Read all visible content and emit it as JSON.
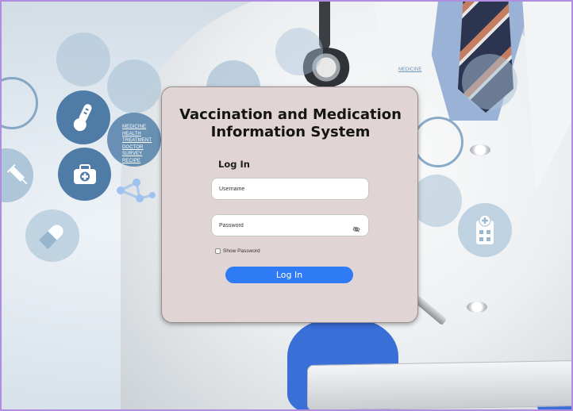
{
  "app": {
    "title_line1": "Vaccination and Medication",
    "title_line2": "Information System"
  },
  "login": {
    "heading": "Log In",
    "username_placeholder": "Username",
    "password_placeholder": "Password",
    "show_password_label": "Show Password",
    "show_password_checked": false,
    "submit_label": "Log In"
  },
  "background": {
    "menu_items": [
      "MEDICINE",
      "HEALTH",
      "TREATMENT",
      "DOCTOR",
      "SURVEY",
      "RECIPE"
    ],
    "right_label": "MEDICINE",
    "faint_items": [
      "MEDICINE",
      "HEALTH",
      "TREATMENT",
      "DOCTOR",
      "SURVEY",
      "RECIPE"
    ]
  },
  "colors": {
    "card_background": "#e0d5d4",
    "primary_button": "#2f7bf5",
    "frame_border": "#b08de0"
  },
  "icons": {
    "password_toggle": "eye-slash-icon",
    "decor": [
      "thermometer-icon",
      "first-aid-kit-icon",
      "syringe-icon",
      "pill-icon",
      "hospital-icon",
      "molecule-icon"
    ]
  }
}
